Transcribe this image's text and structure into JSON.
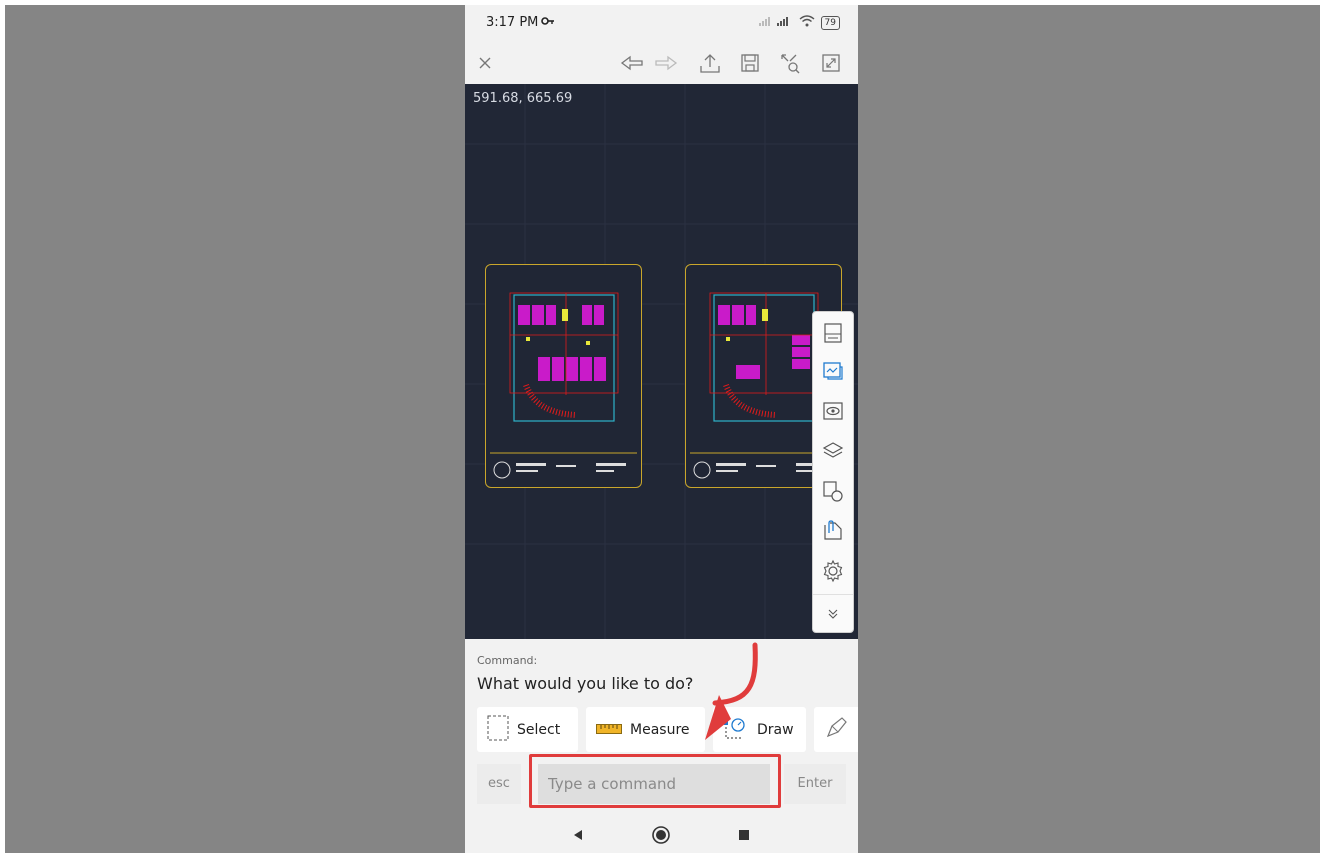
{
  "status_bar": {
    "time": "3:17 PM",
    "key_icon": "key-icon",
    "battery": "79"
  },
  "toolbar": {
    "icons": [
      "close-icon",
      "undo-icon",
      "redo-icon",
      "share-icon",
      "save-icon",
      "zoom-extents-icon",
      "fullscreen-icon"
    ]
  },
  "canvas": {
    "coordinates": "591.68, 665.69"
  },
  "side_panel": {
    "icons": [
      "layout-icon",
      "viewport-icon",
      "visibility-icon",
      "layers-icon",
      "shapes-icon",
      "attach-icon",
      "settings-icon",
      "collapse-icon"
    ]
  },
  "command": {
    "label": "Command:",
    "prompt": "What would you like to do?",
    "chips": [
      {
        "label": "Select",
        "icon": "select-icon"
      },
      {
        "label": "Measure",
        "icon": "ruler-icon"
      },
      {
        "label": "Draw",
        "icon": "draw-icon"
      }
    ],
    "esc_label": "esc",
    "input_placeholder": "Type a command",
    "enter_label": "Enter"
  },
  "colors": {
    "canvas_bg": "#212736",
    "highlight": "#e03c3c",
    "sheet_border": "#c9a62b"
  }
}
